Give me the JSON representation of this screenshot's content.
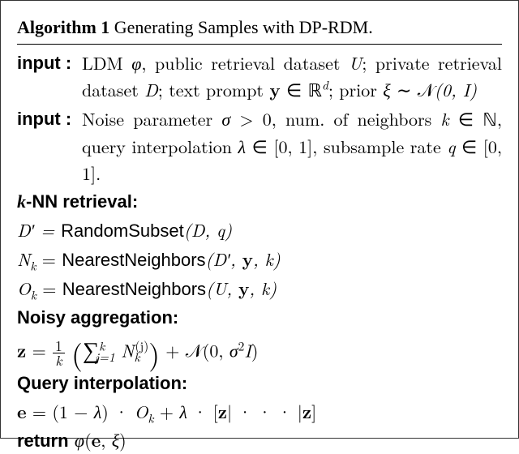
{
  "algo": {
    "label": "Algorithm 1",
    "title": "Generating Samples with DP-RDM."
  },
  "input1": {
    "kw": "input :",
    "seg1": "LDM ",
    "phi": "φ",
    "seg2": ", public retrieval dataset ",
    "U": "U",
    "seg3": "; private retrieval dataset ",
    "D": "D",
    "seg4": "; text prompt ",
    "y": "y",
    "seg5": " ∈ ",
    "Rd": "ℝ",
    "d": "d",
    "seg6": "; prior ",
    "xi": "ξ",
    "seg7": " ∼ ",
    "N": "𝒩",
    "args": "(0, I)"
  },
  "input2": {
    "kw": "input :",
    "seg1": "Noise parameter ",
    "sigma": "σ",
    "gt0": " > 0",
    "seg2": ", num. of neighbors ",
    "k": "k",
    "inN": " ∈ ",
    "Nset": "ℕ",
    "seg3": ", query interpolation ",
    "lambda": "λ",
    "in01a": " ∈ [0, 1]",
    "seg4": ", subsample rate ",
    "q": "q",
    "in01b": " ∈ [0, 1]."
  },
  "sections": {
    "knn_pre_k": "k",
    "knn_post": "-NN retrieval:",
    "noisy": "Noisy aggregation:",
    "interp": "Query interpolation:"
  },
  "knn": {
    "l1_lhs": "D′ = ",
    "l1_fn": "RandomSubset",
    "l1_args": "(D, q)",
    "l2_lhs_N": "N",
    "l2_lhs_k": "k",
    "l2_eq": " = ",
    "l2_fn": "NearestNeighbors",
    "l2_args_open": "(D′, ",
    "l2_y": "y",
    "l2_args_close": ", k)",
    "l3_lhs_O": "O",
    "l3_lhs_k": "k",
    "l3_eq": " = ",
    "l3_fn": "NearestNeighbors",
    "l3_args_open": "(U, ",
    "l3_y": "y",
    "l3_args_close": ", k)"
  },
  "agg": {
    "z": "z",
    "eq": " = ",
    "frac_num": "1",
    "frac_den": "k",
    "sum_sym": "∑",
    "sum_low": "j=1",
    "sum_up": "k",
    "term_N": "N",
    "term_k": "k",
    "term_j": "(j)",
    "plus": " + ",
    "N": "𝒩",
    "Nargs_open": "(0, ",
    "sigma": "σ",
    "sq": "2",
    "I": "I",
    "Nargs_close": ")"
  },
  "interp": {
    "e": "e",
    "eq": " = (1 − ",
    "lambda1": "λ",
    "mid1": ") · ",
    "O": "O",
    "Ok": "k",
    "mid2": " + ",
    "lambda2": "λ",
    "mid3": " · [",
    "z1": "z",
    "dots": "| · · · |",
    "z2": "z",
    "close": "]"
  },
  "ret": {
    "kw": "return",
    "sp": " ",
    "phi": "φ",
    "open": "(",
    "e": "e",
    "comma": ", ",
    "xi": "ξ",
    "close": ")"
  }
}
